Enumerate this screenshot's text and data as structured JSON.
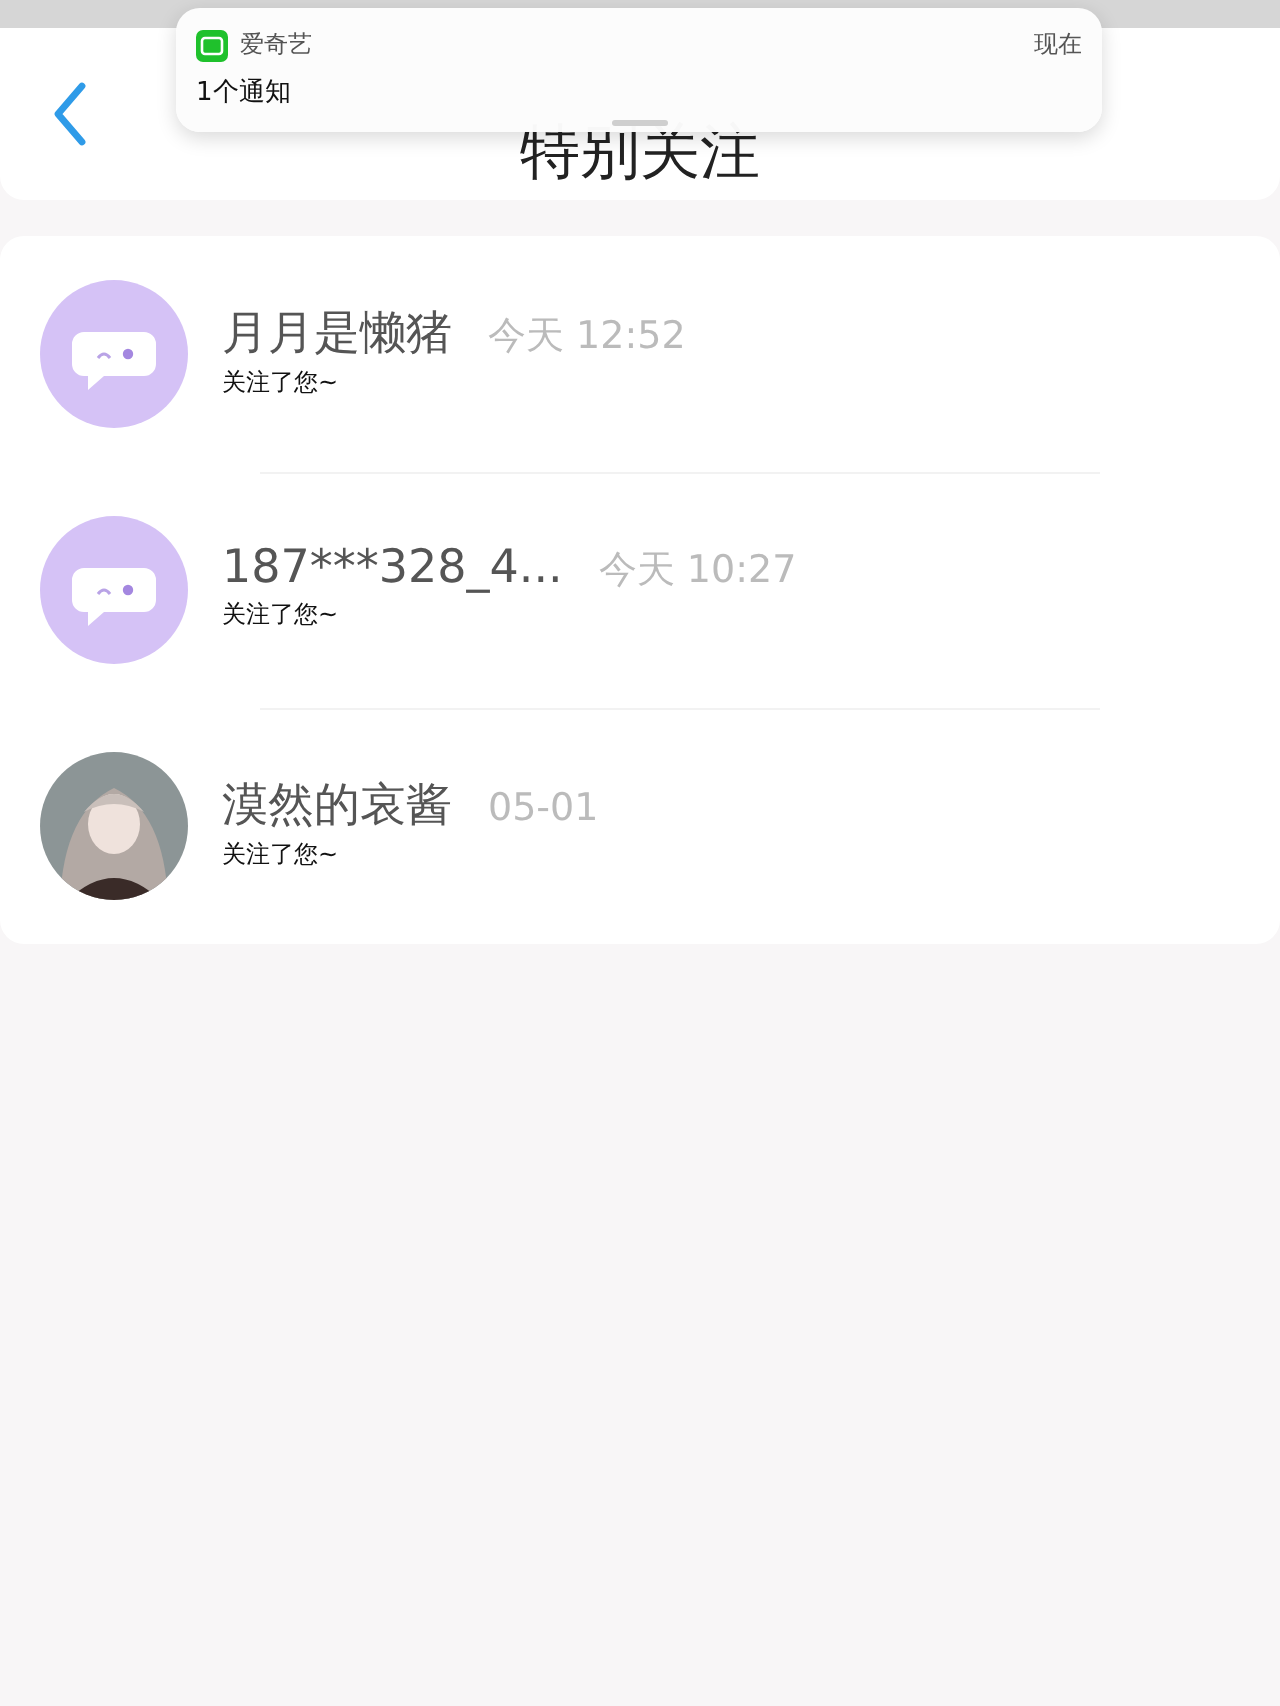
{
  "header": {
    "title": "特别关注"
  },
  "notification": {
    "app": "爱奇艺",
    "time": "现在",
    "message": "1个通知"
  },
  "followers": [
    {
      "avatar": {
        "kind": "default"
      },
      "name": "月月是懒猪",
      "time": "今天 12:52",
      "action": "关注了您~"
    },
    {
      "avatar": {
        "kind": "default"
      },
      "name": "187***328_4...",
      "time": "今天 10:27",
      "action": "关注了您~"
    },
    {
      "name": "漠然的哀酱",
      "time": "05-01",
      "action": "关注了您~"
    }
  ]
}
